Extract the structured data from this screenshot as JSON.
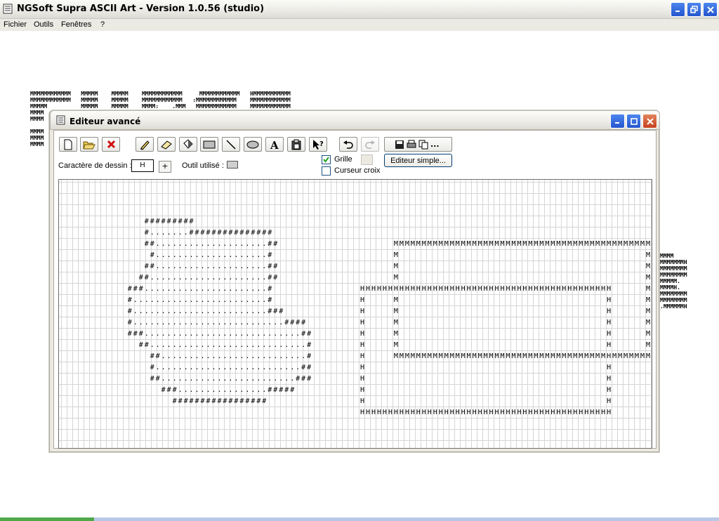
{
  "app": {
    "title": "NGSoft Supra ASCII Art - Version 1.0.56 (studio)",
    "icon": "app-document-icon"
  },
  "menu": {
    "fichier": "Fichier",
    "outils": "Outils",
    "fenetres": "Fenêtres",
    "help": "?"
  },
  "background_art": {
    "left": "MMMMMMMMMMMM   MMMMM    MMMMM    MMMMMMMMMMMM     MMMMMMMMMMMM   HMMMMMMMMMMM\nMMMMMMMMMMMM   MMMMM    MMMMM    MMMMMMMMMMMM   :MMMMMMMMMMMM    MMMMMMMMMMMM\nMMMMM          MMMMM    MMMMM    MMMM:    .MMM   MMMMMMMMMMMM    MMMMMMMMMMMM\nMMMM\nMMMM\n\nMMMM\nMMMM\nMMMM",
    "right": "MMMM\nMMMMMMMH\nMMMMMMMM\nMMMMMMMM\nMMMMM.\nMMMMH.\nMMMMMMMM\nMMMMMMMM\n.MMMMMMH"
  },
  "editor": {
    "title": "Editeur avancé",
    "draw_char_label": "Caractère de dessin :",
    "draw_char_value": "H",
    "plus_label": "+",
    "tool_used_label": "Outil utilisé :",
    "grid_label": "Grille",
    "grid_checked": true,
    "crosshair_label": "Curseur croix",
    "crosshair_checked": false,
    "simple_editor_label": "Editeur simple...",
    "save_more_label": "...",
    "art_left": "\n\n\n               #########\n               #.......###############\n               ##....................##\n                #....................#\n               ##....................##\n              ##.....................##\n            ###......................#\n            #........................#\n            #........................###\n            #...........................####\n            ###............................##\n              ##............................#\n                ##..........................#\n                #..........................##\n                ##........................###\n                  ###................#####\n                    #################",
    "art_right": "\n\n\n\n\n      MMMMMMMMMMMMMMMMMMMMMMMMMMMMMMMMMMMMMMMMMMMMMM\n      M                                            M\n      M                                            M\n      M                                            M\nHHHHHHHHHHHHHHHHHHHHHHHHHHHHHHHHHHHHHHHHHHHHH      M\nH     M                                     H      M\nH     M                                     H      M\nH     M                                     H      M\nH     M                                     H      M\nH     M                                     H      M\nH     MMMMMMMMMMMMMMMMMMMMMMMMMMMMMMMMMMMMMMHMMMMMMM\nH                                           H\nH                                           H\nH                                           H\nH                                           H\nHHHHHHHHHHHHHHHHHHHHHHHHHHHHHHHHHHHHHHHHHHHHH"
  },
  "colors": {
    "titlebar_button_blue": "#2f62d8",
    "close_button_red": "#d2522a",
    "window_face": "#ebe9e0"
  }
}
